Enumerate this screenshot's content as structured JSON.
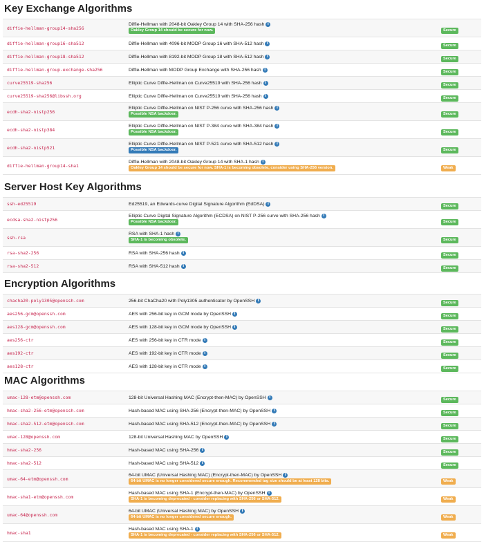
{
  "sections": [
    {
      "title": "Key Exchange Algorithms",
      "rows": [
        {
          "name": "diffie-hellman-group14-sha256",
          "desc": "Diffie-Hellman with 2048-bit Oakley Group 14 with SHA-256 hash",
          "note": "Oakley Group 14 should be secure for now.",
          "note_color": "green",
          "status": "Secure"
        },
        {
          "name": "diffie-hellman-group16-sha512",
          "desc": "Diffie-Hellman with 4096-bit MODP Group 16 with SHA-512 hash",
          "note": "",
          "note_color": "",
          "status": "Secure"
        },
        {
          "name": "diffie-hellman-group18-sha512",
          "desc": "Diffie-Hellman with 8192-bit MODP Group 18 with SHA-512 hash",
          "note": "",
          "note_color": "",
          "status": "Secure"
        },
        {
          "name": "diffie-hellman-group-exchange-sha256",
          "desc": "Diffie-Hellman with MODP Group Exchange with SHA-256 hash",
          "note": "",
          "note_color": "",
          "status": "Secure"
        },
        {
          "name": "curve25519-sha256",
          "desc": "Elliptic Curve Diffie-Hellman on Curve25519 with SHA-256 hash",
          "note": "",
          "note_color": "",
          "status": "Secure"
        },
        {
          "name": "curve25519-sha256@libssh.org",
          "desc": "Elliptic Curve Diffie-Hellman on Curve25519 with SHA-256 hash",
          "note": "",
          "note_color": "",
          "status": "Secure"
        },
        {
          "name": "ecdh-sha2-nistp256",
          "desc": "Elliptic Curve Diffie-Hellman on NIST P-256 curve with SHA-256 hash",
          "note": "Possible NSA backdoor.",
          "note_color": "green",
          "status": "Secure"
        },
        {
          "name": "ecdh-sha2-nistp384",
          "desc": "Elliptic Curve Diffie-Hellman on NIST P-384 curve with SHA-384 hash",
          "note": "Possible NSA backdoor.",
          "note_color": "green",
          "status": "Secure"
        },
        {
          "name": "ecdh-sha2-nistp521",
          "desc": "Elliptic Curve Diffie-Hellman on NIST P-521 curve with SHA-512 hash",
          "note": "Possible NSA backdoor.",
          "note_color": "blue",
          "status": "Secure"
        },
        {
          "name": "diffie-hellman-group14-sha1",
          "desc": "Diffie-Hellman with 2048-bit Oakley Group 14 with SHA-1 hash",
          "note": "Oakley Group 14 should be secure for now. SHA-1 is becoming obsolete, consider using SHA-256 version.",
          "note_color": "orange",
          "status": "Weak"
        }
      ]
    },
    {
      "title": "Server Host Key Algorithms",
      "rows": [
        {
          "name": "ssh-ed25519",
          "desc": "Ed25519, an Edwards-curve Digital Signature Algorithm (EdDSA)",
          "note": "",
          "note_color": "",
          "status": "Secure"
        },
        {
          "name": "ecdsa-sha2-nistp256",
          "desc": "Elliptic Curve Digital Signature Algorithm (ECDSA) on NIST P-256 curve with SHA-256 hash",
          "note": "Possible NSA backdoor.",
          "note_color": "green",
          "status": "Secure"
        },
        {
          "name": "ssh-rsa",
          "desc": "RSA with SHA-1 hash",
          "note": "SHA-1 is becoming obsolete.",
          "note_color": "green",
          "status": "Secure"
        },
        {
          "name": "rsa-sha2-256",
          "desc": "RSA with SHA-256 hash",
          "note": "",
          "note_color": "",
          "status": "Secure"
        },
        {
          "name": "rsa-sha2-512",
          "desc": "RSA with SHA-512 hash",
          "note": "",
          "note_color": "",
          "status": "Secure"
        }
      ]
    },
    {
      "title": "Encryption Algorithms",
      "rows": [
        {
          "name": "chacha20-poly1305@openssh.com",
          "desc": "256-bit ChaCha20 with Poly1305 authenticator by OpenSSH",
          "note": "",
          "note_color": "",
          "status": "Secure"
        },
        {
          "name": "aes256-gcm@openssh.com",
          "desc": "AES with 256-bit key in GCM mode by OpenSSH",
          "note": "",
          "note_color": "",
          "status": "Secure"
        },
        {
          "name": "aes128-gcm@openssh.com",
          "desc": "AES with 128-bit key in GCM mode by OpenSSH",
          "note": "",
          "note_color": "",
          "status": "Secure"
        },
        {
          "name": "aes256-ctr",
          "desc": "AES with 256-bit key in CTR mode",
          "note": "",
          "note_color": "",
          "status": "Secure"
        },
        {
          "name": "aes192-ctr",
          "desc": "AES with 192-bit key in CTR mode",
          "note": "",
          "note_color": "",
          "status": "Secure"
        },
        {
          "name": "aes128-ctr",
          "desc": "AES with 128-bit key in CTR mode",
          "note": "",
          "note_color": "",
          "status": "Secure"
        }
      ]
    },
    {
      "title": "MAC Algorithms",
      "rows": [
        {
          "name": "umac-128-etm@openssh.com",
          "desc": "128-bit Universal Hashing MAC (Encrypt-then-MAC) by OpenSSH",
          "note": "",
          "note_color": "",
          "status": "Secure"
        },
        {
          "name": "hmac-sha2-256-etm@openssh.com",
          "desc": "Hash-based MAC using SHA-256 (Encrypt-then-MAC) by OpenSSH",
          "note": "",
          "note_color": "",
          "status": "Secure"
        },
        {
          "name": "hmac-sha2-512-etm@openssh.com",
          "desc": "Hash-based MAC using SHA-512 (Encrypt-then-MAC) by OpenSSH",
          "note": "",
          "note_color": "",
          "status": "Secure"
        },
        {
          "name": "umac-128@openssh.com",
          "desc": "128-bit Universal Hashing MAC by OpenSSH",
          "note": "",
          "note_color": "",
          "status": "Secure"
        },
        {
          "name": "hmac-sha2-256",
          "desc": "Hash-based MAC using SHA-256",
          "note": "",
          "note_color": "",
          "status": "Secure"
        },
        {
          "name": "hmac-sha2-512",
          "desc": "Hash-based MAC using SHA-512",
          "note": "",
          "note_color": "",
          "status": "Secure"
        },
        {
          "name": "umac-64-etm@openssh.com",
          "desc": "64-bit UMAC (Universal Hashing MAC) (Encrypt-then-MAC) by OpenSSH",
          "note": "64-bit UMAC is no longer considered secure enough. Recommended tag size should be at least 128 bits.",
          "note_color": "orange",
          "status": "Weak"
        },
        {
          "name": "hmac-sha1-etm@openssh.com",
          "desc": "Hash-based MAC using SHA-1 (Encrypt-then-MAC) by OpenSSH",
          "note": "SHA-1 is becoming deprecated - consider replacing with SHA-256 or SHA-512.",
          "note_color": "orange",
          "status": "Weak"
        },
        {
          "name": "umac-64@openssh.com",
          "desc": "64-bit UMAC (Universal Hashing MAC) by OpenSSH",
          "note": "64-bit UMAC is no longer considered secure enough.",
          "note_color": "orange",
          "status": "Weak"
        },
        {
          "name": "hmac-sha1",
          "desc": "Hash-based MAC using SHA-1",
          "note": "SHA-1 is becoming deprecated - consider replacing with SHA-256 or SHA-512.",
          "note_color": "orange",
          "status": "Weak"
        }
      ]
    }
  ],
  "info_icon_glyph": "i",
  "colors": {
    "secure": "#5cb85c",
    "weak": "#f0ad4e",
    "info": "#337ab7",
    "algo_text": "#c7254e"
  }
}
